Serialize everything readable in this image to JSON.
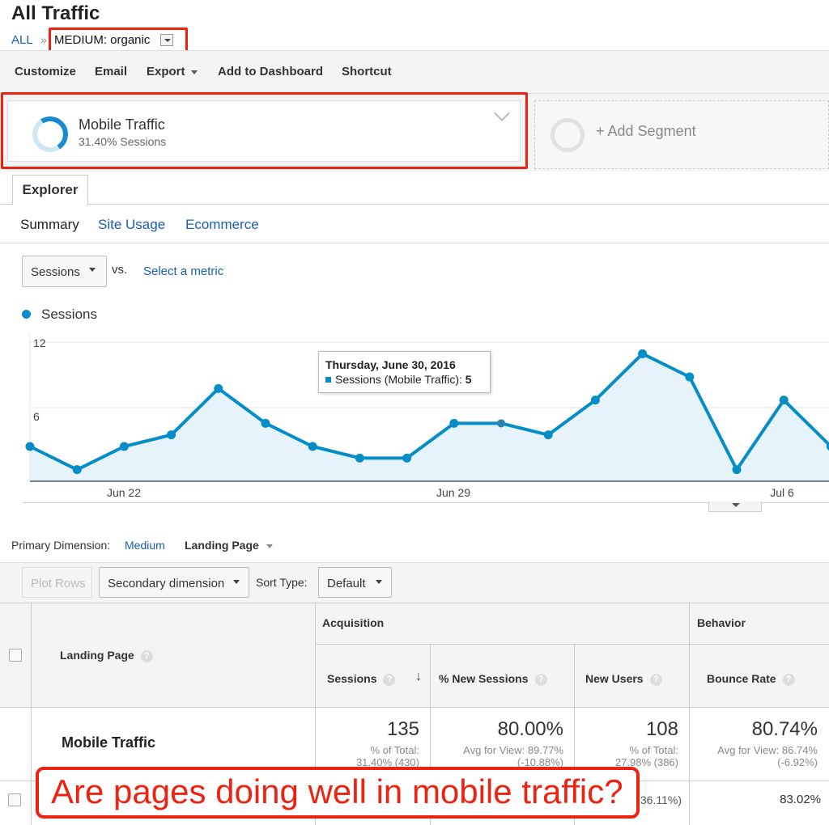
{
  "header": {
    "title": "All Traffic",
    "breadcrumb_root": "ALL",
    "breadcrumb_sep": "»",
    "breadcrumb_current": "MEDIUM: organic"
  },
  "toolbar": {
    "customize": "Customize",
    "email": "Email",
    "export": "Export",
    "add_to_dashboard": "Add to Dashboard",
    "shortcut": "Shortcut"
  },
  "segments": {
    "active_name": "Mobile Traffic",
    "active_sub": "31.40% Sessions",
    "add_label": "+ Add Segment"
  },
  "tabs": {
    "main": "Explorer",
    "sub": [
      "Summary",
      "Site Usage",
      "Ecommerce"
    ]
  },
  "metric": {
    "selected": "Sessions",
    "vs": "vs.",
    "select_metric": "Select a metric"
  },
  "chart_data": {
    "type": "area",
    "series": [
      {
        "name": "Sessions",
        "values": [
          3,
          1,
          3,
          4,
          8,
          5,
          3,
          2,
          2,
          5,
          5,
          4,
          7,
          11,
          9,
          1,
          7,
          3
        ]
      }
    ],
    "x": [
      "2016-06-20",
      "2016-06-21",
      "2016-06-22",
      "2016-06-23",
      "2016-06-24",
      "2016-06-25",
      "2016-06-26",
      "2016-06-27",
      "2016-06-28",
      "2016-06-29",
      "2016-06-30",
      "2016-07-01",
      "2016-07-02",
      "2016-07-03",
      "2016-07-04",
      "2016-07-05",
      "2016-07-06",
      "2016-07-07"
    ],
    "x_tick_labels": [
      "Jun 22",
      "Jun 29",
      "Jul 6"
    ],
    "y_tick_labels": [
      "12",
      "6"
    ],
    "ylim": [
      0,
      12
    ],
    "color": "#058dc7",
    "fill_color": "#e6f3fa",
    "tooltip": {
      "title": "Thursday, June 30, 2016",
      "label": "Sessions (Mobile Traffic):",
      "value": "5"
    }
  },
  "dimension": {
    "label": "Primary Dimension:",
    "medium": "Medium",
    "landing_page": "Landing Page"
  },
  "controls": {
    "plot_rows": "Plot Rows",
    "secondary_dimension": "Secondary dimension",
    "sort_type_label": "Sort Type:",
    "sort_type_value": "Default"
  },
  "table": {
    "group_acquisition": "Acquisition",
    "group_behavior": "Behavior",
    "col_landing_page": "Landing Page",
    "col_sessions": "Sessions",
    "col_new_sessions": "% New Sessions",
    "col_new_users": "New Users",
    "col_bounce_rate": "Bounce Rate",
    "help_glyph": "?",
    "sort_arrow": "↓",
    "summary": {
      "name": "Mobile Traffic",
      "sessions": "135",
      "sessions_sub1": "% of Total:",
      "sessions_sub2": "31.40% (430)",
      "new_sessions": "80.00%",
      "new_sessions_sub1": "Avg for View: 89.77%",
      "new_sessions_sub2": "(-10.88%)",
      "new_users": "108",
      "new_users_sub1": "% of Total:",
      "new_users_sub2": "27.98% (386)",
      "bounce_rate": "80.74%",
      "bounce_rate_sub1": "Avg for View: 86.74%",
      "bounce_rate_sub2": "(-6.92%)"
    },
    "row1": {
      "new_users_partial": "36.11%)",
      "bounce_rate": "83.02%"
    }
  },
  "callout": {
    "text": "Are pages doing well in mobile traffic?",
    "color": "#ee2211"
  }
}
